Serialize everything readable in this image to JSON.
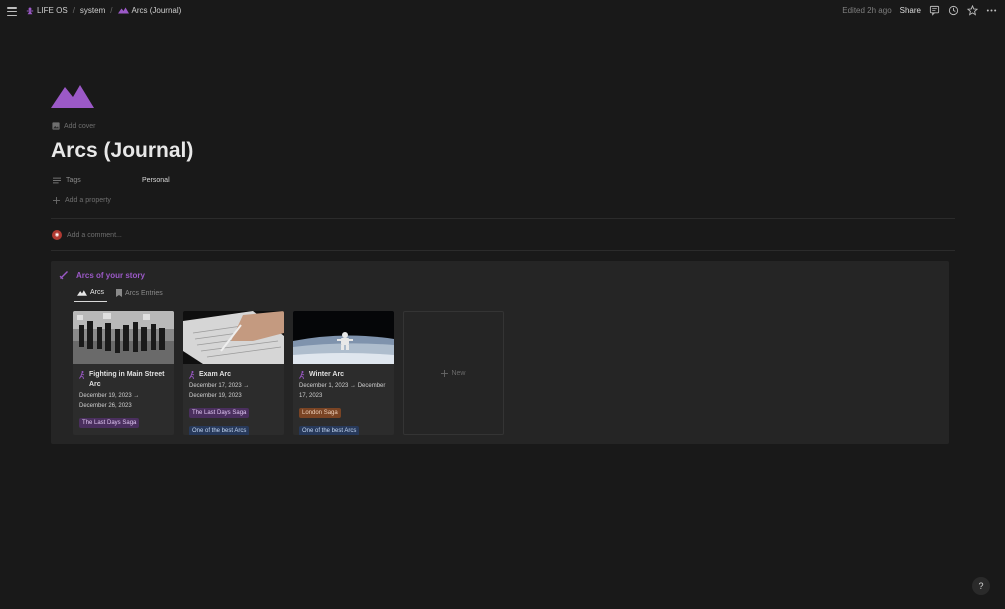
{
  "breadcrumbs": [
    {
      "label": "LIFE OS",
      "icon": "lifeos-icon"
    },
    {
      "label": "system"
    },
    {
      "label": "Arcs (Journal)",
      "icon": "mountain-icon"
    }
  ],
  "topbar": {
    "edited": "Edited 2h ago",
    "share": "Share",
    "icons": [
      "comment-icon",
      "history-icon",
      "star-icon",
      "more-icon"
    ]
  },
  "page": {
    "icon": "mountain-icon",
    "icon_color": "#9b59c7",
    "add_cover": "Add cover",
    "title": "Arcs (Journal)",
    "properties": [
      {
        "name": "Tags",
        "value": "Personal"
      }
    ],
    "add_property": "Add a property",
    "comment_placeholder": "Add a comment..."
  },
  "callout": {
    "title": "Arcs of your story",
    "title_color": "#9b59c7",
    "tabs": [
      {
        "label": "Arcs",
        "icon": "mountain-icon",
        "active": true
      },
      {
        "label": "Arcs Entries",
        "icon": "bookmark-icon",
        "active": false
      }
    ],
    "cards": [
      {
        "title": "Fighting in Main Street Arc",
        "date": "December 19, 2023 → December 26, 2023",
        "tags": [
          {
            "label": "The Last Days Saga",
            "color": "purple"
          }
        ]
      },
      {
        "title": "Exam Arc",
        "date": "December 17, 2023 → December 19, 2023",
        "tags": [
          {
            "label": "The Last Days Saga",
            "color": "purple"
          },
          {
            "label": "One of the best Arcs",
            "color": "blue"
          }
        ]
      },
      {
        "title": "Winter Arc",
        "date": "December 1, 2023 → December 17, 2023",
        "tags": [
          {
            "label": "London Saga",
            "color": "brown"
          },
          {
            "label": "One of the best Arcs",
            "color": "blue"
          }
        ]
      }
    ],
    "new_label": "New"
  },
  "help": "?"
}
